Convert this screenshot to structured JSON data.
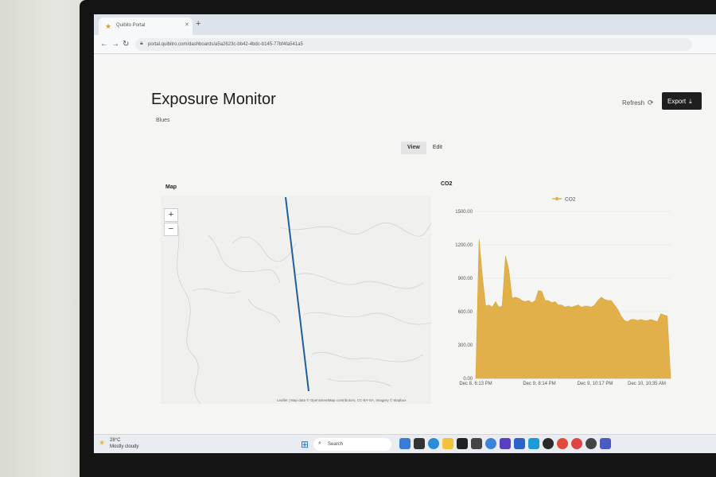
{
  "browser": {
    "tab_title": "Quibito Portal",
    "url": "portal.quibitro.com/dashboards/a5a2623c-bb42-4bdc-b145-77bf4fa541a5"
  },
  "header": {
    "title": "Exposure Monitor",
    "subtitle": "Blues",
    "refresh_label": "Refresh",
    "export_label": "Export"
  },
  "mode_tabs": [
    {
      "label": "View",
      "active": true
    },
    {
      "label": "Edit",
      "active": false
    }
  ],
  "map_panel": {
    "title": "Map",
    "zoom_in": "+",
    "zoom_out": "−",
    "attribution": "Leaflet | Map data © OpenStreetMap contributors, CC-BY-SA, Imagery © Mapbox",
    "route_color": "#1f5fa0"
  },
  "chart_panel": {
    "title": "CO2",
    "legend": "CO2"
  },
  "chart_data": {
    "type": "area",
    "title": "CO2",
    "series": [
      {
        "name": "CO2",
        "color": "#e2b04a",
        "values": [
          0,
          1250,
          920,
          650,
          660,
          640,
          690,
          640,
          650,
          1100,
          980,
          720,
          730,
          720,
          700,
          690,
          700,
          680,
          700,
          790,
          780,
          700,
          700,
          680,
          690,
          660,
          660,
          640,
          650,
          640,
          650,
          660,
          640,
          650,
          650,
          640,
          660,
          700,
          730,
          710,
          700,
          700,
          660,
          620,
          560,
          520,
          510,
          530,
          530,
          520,
          530,
          520,
          520,
          530,
          520,
          510,
          580,
          570,
          560,
          0
        ]
      }
    ],
    "x_ticks": [
      "Dec 8, 6:13 PM",
      "Dec 9, 8:14 PM",
      "Dec 9, 10:17 PM",
      "Dec 10, 10:35 AM"
    ],
    "y_ticks": [
      "0.00",
      "300.00",
      "600.00",
      "900.00",
      "1200.00",
      "1500.00"
    ],
    "ylim": [
      0,
      1500
    ],
    "grid": true,
    "legend_position": "top"
  },
  "taskbar": {
    "weather_temp": "28°C",
    "weather_desc": "Mostly cloudy",
    "search_label": "Search"
  }
}
